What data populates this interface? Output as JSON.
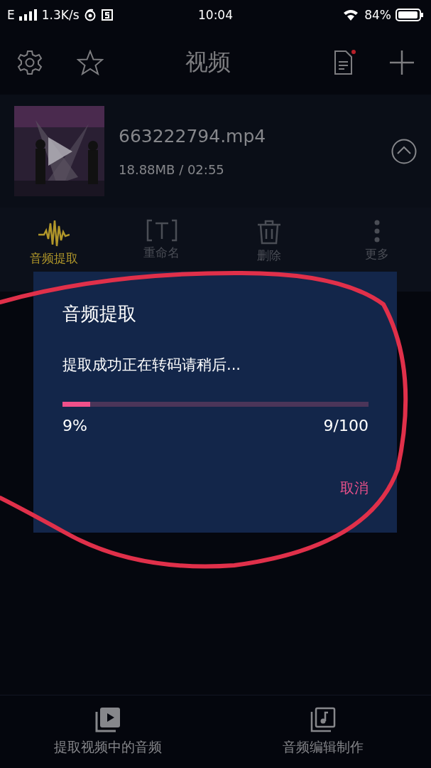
{
  "status_bar": {
    "network": "E",
    "speed": "1.3K/s",
    "time": "10:04",
    "battery": "84%"
  },
  "header": {
    "title": "视频",
    "notification_dot": true
  },
  "file": {
    "name": "663222794.mp4",
    "meta": "18.88MB / 02:55",
    "expanded": true
  },
  "actions": [
    {
      "label": "音频提取",
      "kind": "waveform",
      "selected": true
    },
    {
      "label": "重命名",
      "kind": "rename",
      "selected": false
    },
    {
      "label": "删除",
      "kind": "trash",
      "selected": false
    },
    {
      "label": "更多",
      "kind": "more",
      "selected": false
    }
  ],
  "dialog": {
    "title": "音频提取",
    "message": "提取成功正在转码请稍后...",
    "level": 0.09,
    "percent": "9%",
    "count": "9/100",
    "cancel": "取消"
  },
  "bottom_tabs": [
    {
      "label": "提取视频中的音频",
      "kind": "video"
    },
    {
      "label": "音频编辑制作",
      "kind": "music"
    }
  ]
}
